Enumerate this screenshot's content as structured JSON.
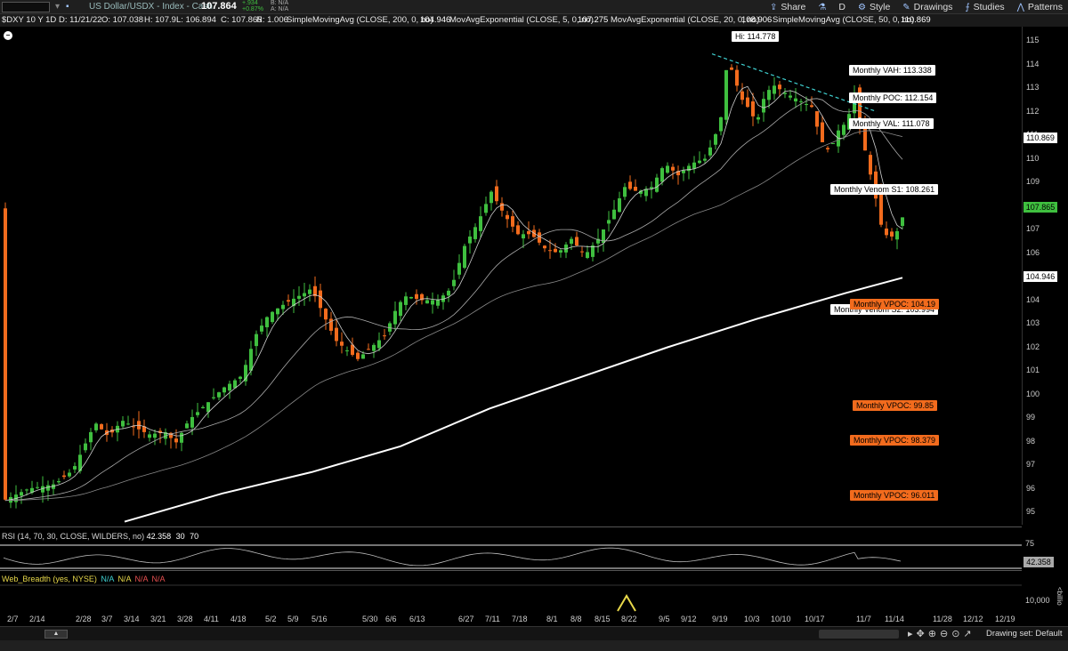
{
  "header": {
    "symbol": "$DXY",
    "description": "US Dollar/USDX - Index - Cash",
    "last": "107.864",
    "change_abs": "+.934",
    "change_pct": "+0.87%",
    "bid": "B: N/A",
    "ask": "A: N/A",
    "toolbar": {
      "share": "Share",
      "style": "Style",
      "drawings": "Drawings",
      "studies": "Studies",
      "patterns": "Patterns",
      "aggregation": "D"
    }
  },
  "info": {
    "period": "$DXY 10 Y 1D",
    "date": "D: 11/21/22",
    "open": "O: 107.038",
    "high": "H: 107.9",
    "low": "L: 106.894",
    "close": "C: 107.865",
    "range": "R: 1.006",
    "sma200_label": "SimpleMovingAvg (CLOSE, 200, 0, no)",
    "sma200_value": "104.946",
    "ema5_label": "MovAvgExponential (CLOSE, 5, 0, no)",
    "ema5_value": "107.275",
    "ema20_label": "MovAvgExponential (CLOSE, 20, 0, no)",
    "ema20_value": "108.906",
    "sma50_label": "SimpleMovingAvg (CLOSE, 50, 0, no)",
    "sma50_value": "110.869"
  },
  "annotations": {
    "hi": "Hi: 114.778",
    "vah": "Monthly VAH: 113.338",
    "poc": "Monthly POC: 112.154",
    "val": "Monthly VAL: 111.078",
    "venom_s1": "Monthly Venom S1: 108.261",
    "venom_s2": "Monthly Venom S2: 103.994",
    "vpoc1": "Monthly VPOC: 104.19",
    "vpoc2": "Monthly VPOC: 99.85",
    "vpoc3": "Monthly VPOC: 98.379",
    "vpoc4": "Monthly VPOC: 96.011"
  },
  "price_axis": {
    "ticks": [
      "115",
      "114",
      "113",
      "112",
      "111",
      "110",
      "109",
      "108",
      "107",
      "106",
      "105",
      "104",
      "103",
      "102",
      "101",
      "100",
      "99",
      "98",
      "97",
      "96",
      "95"
    ],
    "sma50_box": "110.869",
    "last_box": "107.865",
    "sma200_box": "104.946"
  },
  "rsi": {
    "label": "RSI (14, 70, 30, CLOSE, WILDERS, no)",
    "value": "42.358",
    "lower": "30",
    "upper": "70",
    "axis_75": "75",
    "axis_value": "42.358"
  },
  "web_breadth": {
    "label": "Web_Breadth (yes, NYSE)",
    "v1": "N/A",
    "v2": "N/A",
    "v3": "N/A",
    "v4": "N/A",
    "axis": "10,000",
    "axis_unit": "<billio"
  },
  "time_axis": [
    "2/7",
    "2/14",
    "2/28",
    "3/7",
    "3/14",
    "3/21",
    "3/28",
    "4/11",
    "4/18",
    "5/2",
    "5/9",
    "5/16",
    "5/30",
    "6/6",
    "6/13",
    "6/27",
    "7/11",
    "7/18",
    "8/1",
    "8/8",
    "8/15",
    "8/22",
    "9/5",
    "9/12",
    "9/19",
    "10/3",
    "10/10",
    "10/17",
    "11/7",
    "11/14",
    "11/28",
    "12/12",
    "12/19"
  ],
  "footer": {
    "drawing_set": "Drawing set: Default"
  },
  "colors": {
    "up": "#3fbf3f",
    "down": "#f26b1d",
    "last_box": "#3fbf3f",
    "vpoc": "#f26b1d"
  }
}
